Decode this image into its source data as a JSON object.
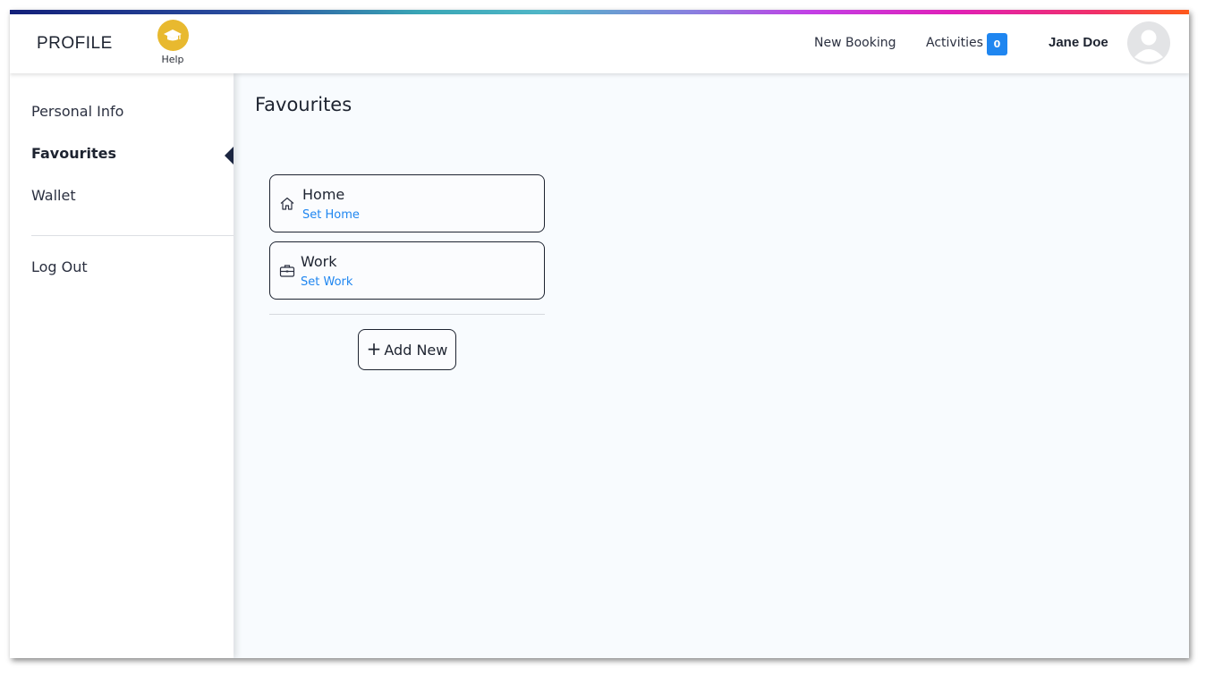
{
  "header": {
    "brand": "PROFILE",
    "help_label": "Help",
    "new_booking": "New Booking",
    "activities": "Activities",
    "activities_count": "0",
    "user_name": "Jane Doe"
  },
  "sidebar": {
    "items": [
      {
        "label": "Personal Info"
      },
      {
        "label": "Favourites"
      },
      {
        "label": "Wallet"
      },
      {
        "label": "Log Out"
      }
    ],
    "active": "Favourites"
  },
  "main": {
    "title": "Favourites",
    "favourites": [
      {
        "title": "Home",
        "action": "Set Home",
        "icon": "home-icon"
      },
      {
        "title": "Work",
        "action": "Set Work",
        "icon": "briefcase-icon"
      }
    ],
    "add_new_label": "Add New"
  },
  "colors": {
    "accent_blue": "#1f86f0",
    "help_yellow": "#e8b92f",
    "text_dark": "#1d2330"
  }
}
